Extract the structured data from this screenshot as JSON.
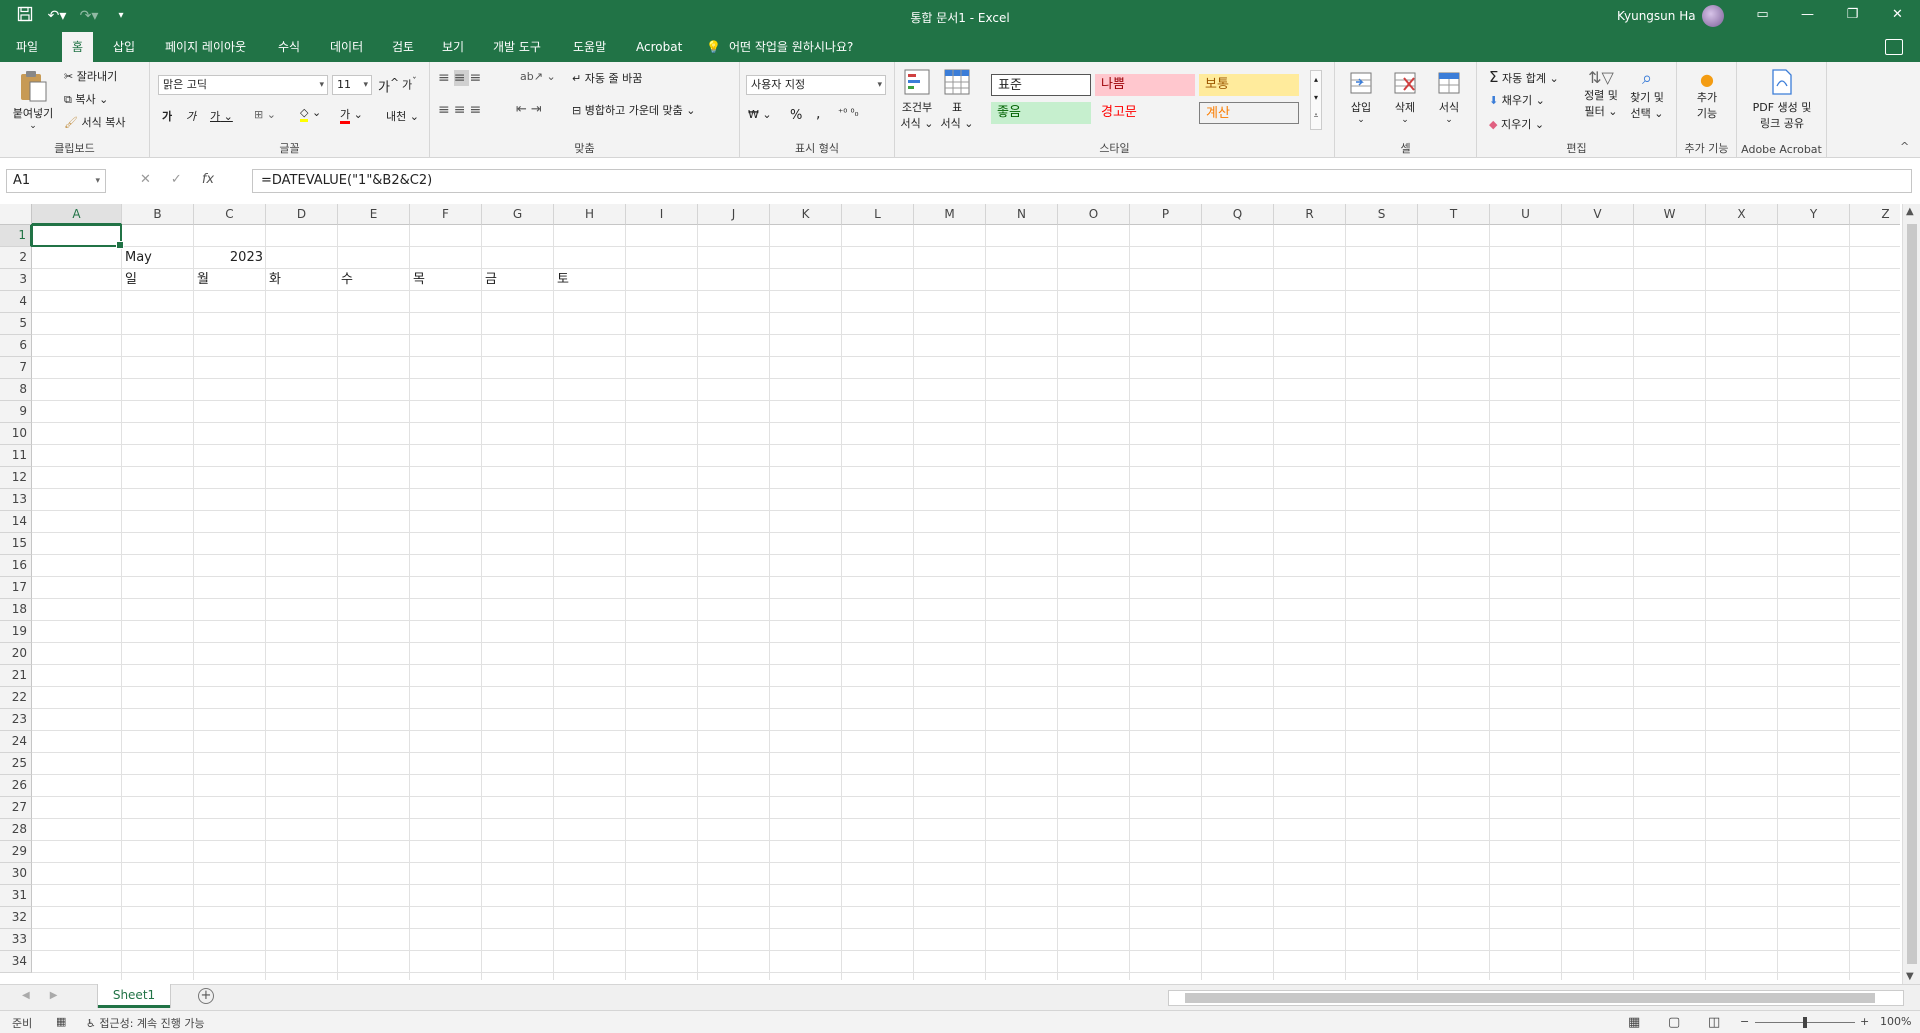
{
  "app": {
    "title": "통합 문서1  -  Excel",
    "user": "Kyungsun Ha"
  },
  "tabs": [
    {
      "label": "파일"
    },
    {
      "label": "홈",
      "active": true
    },
    {
      "label": "삽입"
    },
    {
      "label": "페이지 레이아웃"
    },
    {
      "label": "수식"
    },
    {
      "label": "데이터"
    },
    {
      "label": "검토"
    },
    {
      "label": "보기"
    },
    {
      "label": "개발 도구"
    },
    {
      "label": "도움말"
    },
    {
      "label": "Acrobat"
    }
  ],
  "tell_me": "어떤 작업을 원하시나요?",
  "ribbon": {
    "clipboard": {
      "label": "클립보드",
      "paste": "붙여넣기",
      "cut": "잘라내기",
      "copy": "복사",
      "format_painter": "서식 복사"
    },
    "font": {
      "label": "글꼴",
      "font_name": "맑은 고딕",
      "font_size": "11",
      "bold": "가",
      "italic": "가",
      "underline": "가",
      "grow": "가",
      "shrink": "가",
      "font_color_char": "가",
      "phonetic": "내천"
    },
    "alignment": {
      "label": "맞춤",
      "wrap": "자동 줄 바꿈",
      "merge": "병합하고 가운데 맞춤"
    },
    "number": {
      "label": "표시 형식",
      "format": "사용자 지정",
      "percent": "%",
      "comma": ","
    },
    "styles": {
      "label": "스타일",
      "conditional": "조건부\n서식",
      "conditional_1": "조건부",
      "conditional_2": "서식",
      "table_1": "표",
      "table_2": "서식",
      "normal": "표준",
      "bad": "나쁨",
      "neutral": "보통",
      "good": "좋음",
      "warning": "경고문",
      "calculation": "계산",
      "colors": {
        "bad_bg": "#ffc7ce",
        "bad_fg": "#9c0006",
        "neutral_bg": "#ffeb9c",
        "neutral_fg": "#9c5700",
        "good_bg": "#c6efce",
        "good_fg": "#006100",
        "warning_fg": "#ff0000",
        "calc_bg": "#f2f2f2",
        "calc_fg": "#fa7d00"
      }
    },
    "cells": {
      "label": "셀",
      "insert": "삽입",
      "delete": "삭제",
      "format": "서식"
    },
    "editing": {
      "label": "편집",
      "autosum": "자동 합계",
      "fill": "채우기",
      "clear": "지우기",
      "sort_1": "정렬 및",
      "sort_2": "필터",
      "find_1": "찾기 및",
      "find_2": "선택"
    },
    "addins": {
      "label": "추가 기능",
      "btn_1": "추가",
      "btn_2": "기능"
    },
    "acrobat": {
      "label": "Adobe Acrobat",
      "btn_1": "PDF 생성 및",
      "btn_2": "링크 공유"
    }
  },
  "formula_bar": {
    "name_box": "A1",
    "cancel": "✕",
    "enter": "✓",
    "fx": "fx",
    "formula": "=DATEVALUE(\"1\"&B2&C2)"
  },
  "columns": [
    "A",
    "B",
    "C",
    "D",
    "E",
    "F",
    "G",
    "H",
    "I",
    "J",
    "K",
    "L",
    "M",
    "N",
    "O",
    "P",
    "Q",
    "R",
    "S",
    "T",
    "U",
    "V",
    "W",
    "X",
    "Y",
    "Z"
  ],
  "rows": [
    "1",
    "2",
    "3",
    "4",
    "5",
    "6",
    "7",
    "8",
    "9",
    "10",
    "11",
    "12",
    "13",
    "14",
    "15",
    "16",
    "17",
    "18",
    "19",
    "20",
    "21",
    "22",
    "23",
    "24",
    "25",
    "26",
    "27",
    "28",
    "29",
    "30",
    "31",
    "32",
    "33",
    "34"
  ],
  "cells": {
    "B2": "May",
    "C2": "2023",
    "B3": "일",
    "C3": "월",
    "D3": "화",
    "E3": "수",
    "F3": "목",
    "G3": "금",
    "H3": "토"
  },
  "sheets": [
    {
      "label": "Sheet1",
      "active": true
    }
  ],
  "status": {
    "ready": "준비",
    "accessibility": "접근성: 계속 진행 가능",
    "zoom": "100%"
  },
  "accent": "#217346"
}
